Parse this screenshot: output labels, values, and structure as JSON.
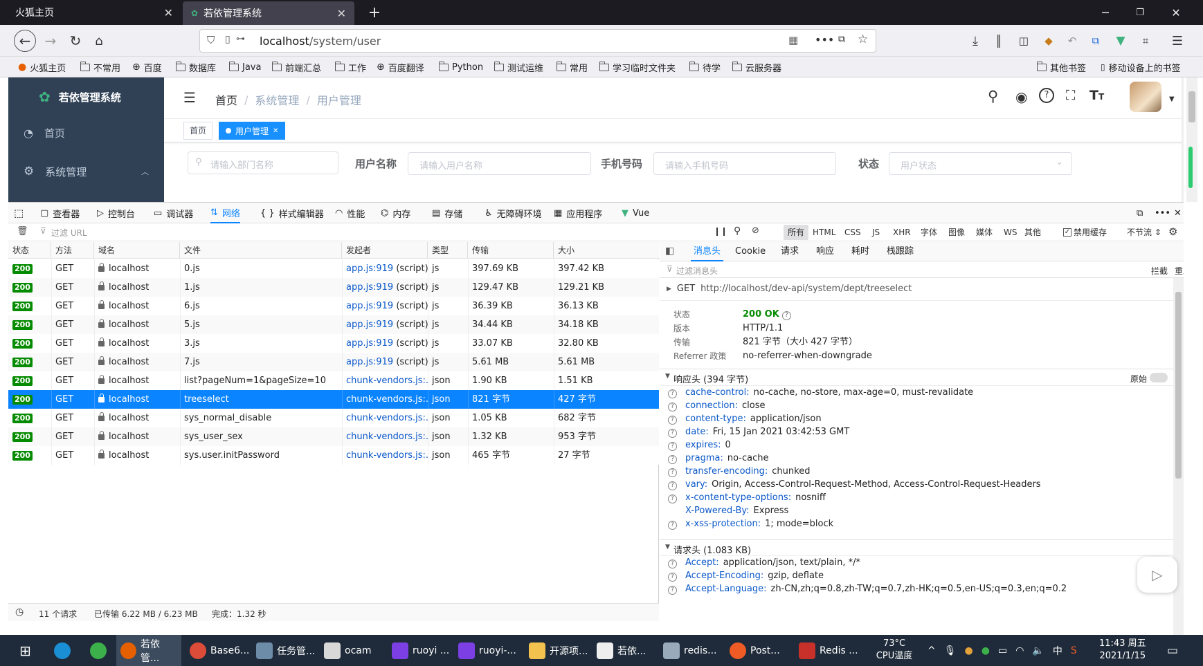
{
  "browser": {
    "tabs": [
      {
        "title": "火狐主页"
      },
      {
        "title": "若依管理系统"
      }
    ],
    "url_host": "localhost",
    "url_path": "/system/user",
    "bookmarks": [
      "火狐主页",
      "不常用",
      "百度",
      "数据库",
      "Java",
      "前端汇总",
      "工作",
      "百度翻译",
      "Python",
      "测试运维",
      "常用",
      "学习临时文件夹",
      "待学",
      "云服务器"
    ],
    "bookmarks_right": [
      "其他书签",
      "移动设备上的书签"
    ]
  },
  "app": {
    "logo_title": "若依管理系统",
    "sidebar": [
      {
        "label": "首页"
      },
      {
        "label": "系统管理"
      }
    ],
    "breadcrumb": [
      "首页",
      "系统管理",
      "用户管理"
    ],
    "tags": [
      {
        "label": "首页"
      },
      {
        "label": "用户管理"
      }
    ],
    "search": {
      "dept_placeholder": "请输入部门名称",
      "username_label": "用户名称",
      "username_placeholder": "请输入用户名称",
      "phone_label": "手机号码",
      "phone_placeholder": "请输入手机号码",
      "status_label": "状态",
      "status_placeholder": "用户状态"
    }
  },
  "devtools": {
    "tools": [
      "查看器",
      "控制台",
      "调试器",
      "网络",
      "样式编辑器",
      "性能",
      "内存",
      "存储",
      "无障碍环境",
      "应用程序",
      "Vue"
    ],
    "filter_placeholder": "过滤 URL",
    "type_filters": [
      "所有",
      "HTML",
      "CSS",
      "JS",
      "XHR",
      "字体",
      "图像",
      "媒体",
      "WS",
      "其他"
    ],
    "disable_cache": "禁用缓存",
    "throttle": "不节流 ⇕",
    "columns": [
      "状态",
      "方法",
      "域名",
      "文件",
      "发起者",
      "类型",
      "传输",
      "大小"
    ],
    "requests": [
      {
        "status": "200",
        "method": "GET",
        "domain": "localhost",
        "file": "0.js",
        "initiator": "app.js:919",
        "initiator_suffix": " (script)",
        "type": "js",
        "transfer": "397.69 KB",
        "size": "397.42 KB"
      },
      {
        "status": "200",
        "method": "GET",
        "domain": "localhost",
        "file": "1.js",
        "initiator": "app.js:919",
        "initiator_suffix": " (script)",
        "type": "js",
        "transfer": "129.47 KB",
        "size": "129.21 KB"
      },
      {
        "status": "200",
        "method": "GET",
        "domain": "localhost",
        "file": "6.js",
        "initiator": "app.js:919",
        "initiator_suffix": " (script)",
        "type": "js",
        "transfer": "36.39 KB",
        "size": "36.13 KB"
      },
      {
        "status": "200",
        "method": "GET",
        "domain": "localhost",
        "file": "5.js",
        "initiator": "app.js:919",
        "initiator_suffix": " (script)",
        "type": "js",
        "transfer": "34.44 KB",
        "size": "34.18 KB"
      },
      {
        "status": "200",
        "method": "GET",
        "domain": "localhost",
        "file": "3.js",
        "initiator": "app.js:919",
        "initiator_suffix": " (script)",
        "type": "js",
        "transfer": "33.07 KB",
        "size": "32.80 KB"
      },
      {
        "status": "200",
        "method": "GET",
        "domain": "localhost",
        "file": "7.js",
        "initiator": "app.js:919",
        "initiator_suffix": " (script)",
        "type": "js",
        "transfer": "5.61 MB",
        "size": "5.61 MB"
      },
      {
        "status": "200",
        "method": "GET",
        "domain": "localhost",
        "file": "list?pageNum=1&pageSize=10",
        "initiator": "chunk-vendors.js:...",
        "initiator_suffix": "",
        "type": "json",
        "transfer": "1.90 KB",
        "size": "1.51 KB"
      },
      {
        "status": "200",
        "method": "GET",
        "domain": "localhost",
        "file": "treeselect",
        "initiator": "chunk-vendors.js:...",
        "initiator_suffix": "",
        "type": "json",
        "transfer": "821 字节",
        "size": "427 字节"
      },
      {
        "status": "200",
        "method": "GET",
        "domain": "localhost",
        "file": "sys_normal_disable",
        "initiator": "chunk-vendors.js:...",
        "initiator_suffix": "",
        "type": "json",
        "transfer": "1.05 KB",
        "size": "682 字节"
      },
      {
        "status": "200",
        "method": "GET",
        "domain": "localhost",
        "file": "sys_user_sex",
        "initiator": "chunk-vendors.js:...",
        "initiator_suffix": "",
        "type": "json",
        "transfer": "1.32 KB",
        "size": "953 字节"
      },
      {
        "status": "200",
        "method": "GET",
        "domain": "localhost",
        "file": "sys.user.initPassword",
        "initiator": "chunk-vendors.js:...",
        "initiator_suffix": "",
        "type": "json",
        "transfer": "465 字节",
        "size": "27 字节"
      }
    ],
    "selected_index": 7,
    "footer": {
      "count": "11 个请求",
      "transferred": "已传输 6.22 MB / 6.23 MB",
      "finish": "完成：1.32 秒"
    },
    "detail_tabs": [
      "消息头",
      "Cookie",
      "请求",
      "响应",
      "耗时",
      "栈跟踪"
    ],
    "detail_filter_placeholder": "过滤消息头",
    "block_label": "拦截",
    "resend_label": "重发 ⇕",
    "request_method": "GET",
    "request_url": "http://localhost/dev-api/system/dept/treeselect",
    "summary": [
      {
        "k": "状态",
        "v": "200 OK"
      },
      {
        "k": "版本",
        "v": "HTTP/1.1"
      },
      {
        "k": "传输",
        "v": "821 字节（大小 427 字节）"
      },
      {
        "k": "Referrer 政策",
        "v": "no-referrer-when-downgrade"
      }
    ],
    "response_headers_title": "响应头 (394 字节)",
    "raw_label": "原始",
    "response_headers": [
      {
        "k": "cache-control:",
        "v": "no-cache, no-store, max-age=0, must-revalidate"
      },
      {
        "k": "connection:",
        "v": "close"
      },
      {
        "k": "content-type:",
        "v": "application/json"
      },
      {
        "k": "date:",
        "v": "Fri, 15 Jan 2021 03:42:53 GMT"
      },
      {
        "k": "expires:",
        "v": "0"
      },
      {
        "k": "pragma:",
        "v": "no-cache"
      },
      {
        "k": "transfer-encoding:",
        "v": "chunked"
      },
      {
        "k": "vary:",
        "v": "Origin, Access-Control-Request-Method, Access-Control-Request-Headers"
      },
      {
        "k": "x-content-type-options:",
        "v": "nosniff"
      },
      {
        "k": "X-Powered-By:",
        "v": "Express"
      },
      {
        "k": "x-xss-protection:",
        "v": "1; mode=block"
      }
    ],
    "request_headers_title": "请求头 (1.083 KB)",
    "request_headers": [
      {
        "k": "Accept:",
        "v": "application/json, text/plain, */*"
      },
      {
        "k": "Accept-Encoding:",
        "v": "gzip, deflate"
      },
      {
        "k": "Accept-Language:",
        "v": "zh-CN,zh;q=0.8,zh-TW;q=0.7,zh-HK;q=0.5,en-US;q=0.3,en;q=0.2"
      }
    ]
  },
  "taskbar": {
    "apps": [
      "若依管...",
      "Base6...",
      "任务管...",
      "ocam",
      "ruoyi ...",
      "ruoyi-...",
      "开源项...",
      "若依...",
      "redis...",
      "Post...",
      "Redis ..."
    ],
    "cpu_temp": "73°C",
    "cpu_label": "CPU温度",
    "ime": "中",
    "time": "11:43 周五",
    "date": "2021/1/15"
  }
}
